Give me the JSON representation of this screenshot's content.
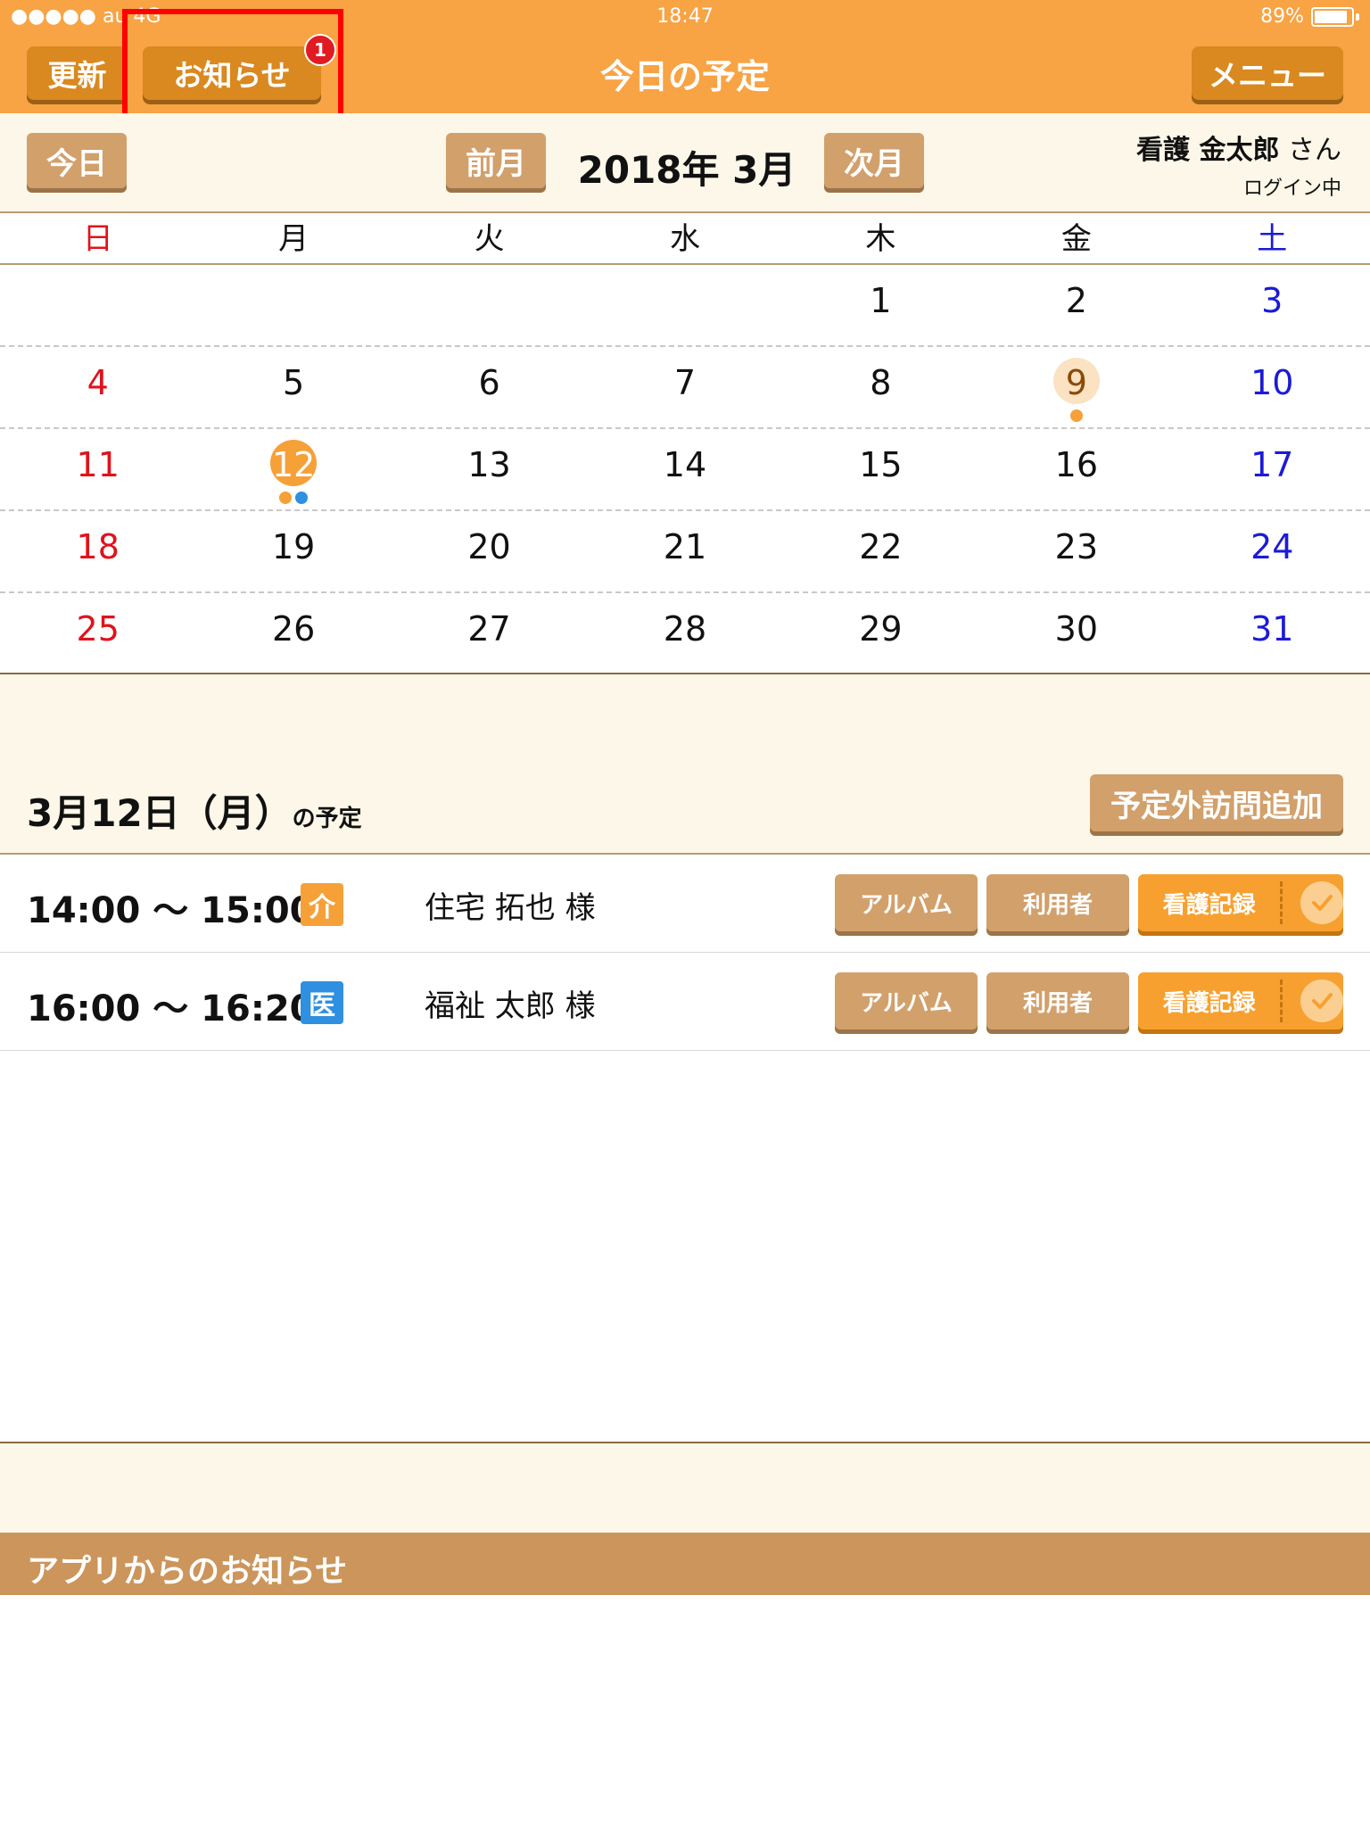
{
  "status_bar": {
    "carrier": "●●●●● au 4G",
    "time": "18:47",
    "battery": "89%",
    "battery_level": 0.89
  },
  "header": {
    "refresh_label": "更新",
    "notices_label": "お知らせ",
    "notices_badge": "1",
    "title": "今日の予定",
    "menu_label": "メニュー"
  },
  "month_nav": {
    "today_label": "今日",
    "prev_label": "前月",
    "month": "2018年 3月",
    "next_label": "次月",
    "user_name": "看護 金太郎",
    "user_suffix": "さん",
    "login_status": "ログイン中"
  },
  "calendar": {
    "weekdays": [
      "日",
      "月",
      "火",
      "水",
      "木",
      "金",
      "土"
    ],
    "weeks": [
      [
        "",
        "",
        "",
        "",
        "1",
        "2",
        "3"
      ],
      [
        "4",
        "5",
        "6",
        "7",
        "8",
        "9",
        "10"
      ],
      [
        "11",
        "12",
        "13",
        "14",
        "15",
        "16",
        "17"
      ],
      [
        "18",
        "19",
        "20",
        "21",
        "22",
        "23",
        "24"
      ],
      [
        "25",
        "26",
        "27",
        "28",
        "29",
        "30",
        "31"
      ]
    ],
    "selected_day": "12",
    "highlighted_day": "9",
    "event_dots": {
      "9": [
        "#f6a038"
      ],
      "12": [
        "#f6a038",
        "#2f8fe0"
      ]
    }
  },
  "schedule": {
    "date_label": "3月12日（月）",
    "date_suffix": "の予定",
    "add_visit_label": "予定外訪問追加",
    "rows": [
      {
        "time": "14:00 〜 15:00",
        "tag": "介",
        "tag_color": "#f6a038",
        "patient": "住宅 拓也 様",
        "album_label": "アルバム",
        "user_label": "利用者",
        "record_label": "看護記録"
      },
      {
        "time": "16:00 〜 16:20",
        "tag": "医",
        "tag_color": "#2f8fe0",
        "patient": "福祉 太郎 様",
        "album_label": "アルバム",
        "user_label": "利用者",
        "record_label": "看護記録"
      }
    ]
  },
  "app_notices": {
    "title": "アプリからのお知らせ"
  }
}
